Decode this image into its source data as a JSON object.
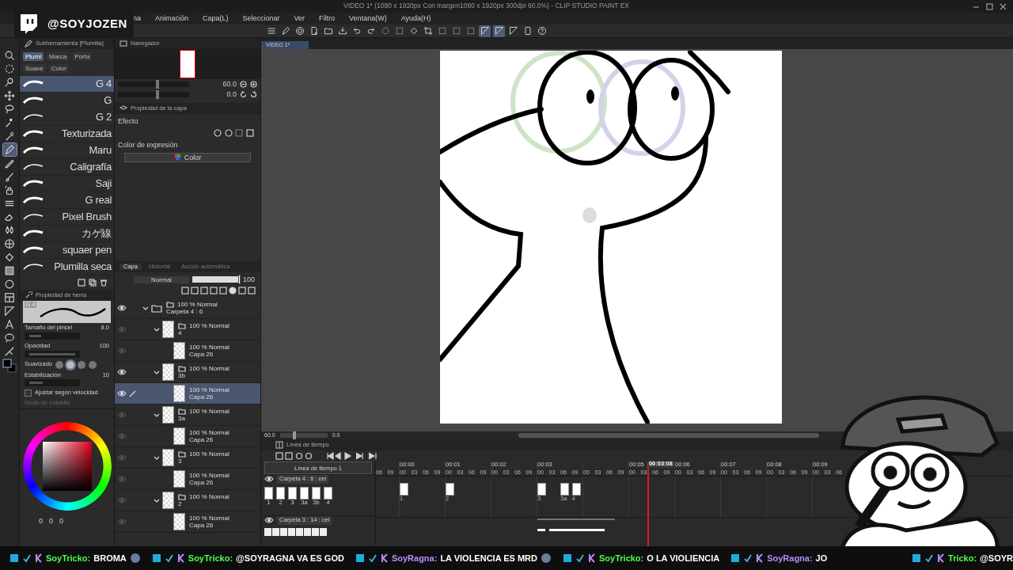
{
  "overlay": {
    "handle": "@SOYJOZEN"
  },
  "window": {
    "title": "VIDEO 1* (1080 x 1920px Con margen1080 x 1920px 300dpi 60.0%)  - CLIP STUDIO PAINT EX"
  },
  "menu": [
    "na",
    "Animación",
    "Capa(L)",
    "Seleccionar",
    "Ver",
    "Filtro",
    "Ventana(W)",
    "Ayuda(H)"
  ],
  "toolbar": [
    {
      "kind": "menu",
      "on": false
    },
    {
      "kind": "pen",
      "on": false
    },
    {
      "kind": "spiral",
      "on": false
    },
    {
      "kind": "new",
      "on": false
    },
    {
      "kind": "open",
      "on": false
    },
    {
      "kind": "save",
      "on": false
    },
    {
      "kind": "undo",
      "on": false
    },
    {
      "kind": "redo",
      "on": false
    },
    {
      "kind": "spinner",
      "on": false
    },
    {
      "kind": "blank",
      "on": false
    },
    {
      "kind": "fill",
      "on": false
    },
    {
      "kind": "crop",
      "on": false
    },
    {
      "kind": "blank",
      "on": false
    },
    {
      "kind": "blank",
      "on": false
    },
    {
      "kind": "blank",
      "on": false
    },
    {
      "kind": "ruler",
      "on": true
    },
    {
      "kind": "ruler",
      "on": true
    },
    {
      "kind": "ruler",
      "on": false
    },
    {
      "kind": "device",
      "on": false
    },
    {
      "kind": "help",
      "on": false
    }
  ],
  "tools": [
    {
      "kind": "zoom",
      "selected": false
    },
    {
      "kind": "select",
      "selected": false
    },
    {
      "kind": "eyedrop2",
      "selected": false
    },
    {
      "kind": "move",
      "selected": false
    },
    {
      "kind": "lasso",
      "selected": false
    },
    {
      "kind": "wand",
      "selected": false
    },
    {
      "kind": "eyedropper",
      "selected": false
    },
    {
      "kind": "pen",
      "selected": true
    },
    {
      "kind": "pencil",
      "selected": false
    },
    {
      "kind": "brush",
      "selected": false
    },
    {
      "kind": "airbrush",
      "selected": false
    },
    {
      "kind": "decoration",
      "selected": false
    },
    {
      "kind": "eraser",
      "selected": false
    },
    {
      "kind": "blend",
      "selected": false
    },
    {
      "kind": "frame",
      "selected": false
    },
    {
      "kind": "fill",
      "selected": false
    },
    {
      "kind": "gradient",
      "selected": false
    },
    {
      "kind": "figure",
      "selected": false
    },
    {
      "kind": "panel",
      "selected": false
    },
    {
      "kind": "ruler",
      "selected": false
    },
    {
      "kind": "text",
      "selected": false
    },
    {
      "kind": "balloon",
      "selected": false
    },
    {
      "kind": "correct",
      "selected": false
    }
  ],
  "subtool": {
    "title": "Subherramienta [Plumilla]",
    "groups": [
      {
        "label": "Plumi",
        "selected": true
      },
      {
        "label": "Marca",
        "selected": false
      },
      {
        "label": "Porta",
        "selected": false
      },
      {
        "label": "Suave",
        "selected": false
      },
      {
        "label": "Color",
        "selected": false
      }
    ],
    "brushes": [
      {
        "name": "G 4",
        "selected": true
      },
      {
        "name": "G",
        "selected": false
      },
      {
        "name": "G 2",
        "selected": false
      },
      {
        "name": "Texturizada",
        "selected": false
      },
      {
        "name": "Maru",
        "selected": false
      },
      {
        "name": "Caligrafía",
        "selected": false
      },
      {
        "name": "Saji",
        "selected": false
      },
      {
        "name": "G real",
        "selected": false
      },
      {
        "name": "Pixel Brush",
        "selected": false
      },
      {
        "name": "カゲ線",
        "selected": false
      },
      {
        "name": "squaer pen",
        "selected": false
      },
      {
        "name": "Plumilla seca",
        "selected": false
      }
    ]
  },
  "tool_property": {
    "title": "Propiedad de herra",
    "brush": "G 4",
    "rows": [
      {
        "kind": "slider",
        "label": "Tamaño del pincel",
        "value": "8.0",
        "level": 0.25
      },
      {
        "kind": "slider",
        "label": "Opacidad",
        "value": "100",
        "level": 1
      },
      {
        "kind": "smoothing",
        "label": "Suavizado",
        "options": [
          {
            "selected": false
          },
          {
            "selected": true
          },
          {
            "selected": false
          },
          {
            "selected": false
          }
        ]
      },
      {
        "kind": "slider",
        "label": "Estabilización",
        "value": "10",
        "level": 0.3
      }
    ],
    "speed": {
      "label": "Ajustar según velocidad",
      "checked": false
    },
    "mode_label": "Modo de estabiliz"
  },
  "color_values": [
    "0",
    "0",
    "0"
  ],
  "navigator": {
    "title": "Navegador",
    "sliders": [
      {
        "kind": "zoom",
        "value": "60.0",
        "level": 0.55
      },
      {
        "kind": "angle",
        "value": "0.0",
        "level": 0.55
      }
    ]
  },
  "layer_property": {
    "title": "Propiedad de la capa",
    "effect_label": "Efecto",
    "expression_label": "Color de expresión",
    "expression": "Color"
  },
  "layers": {
    "tabs": [
      {
        "label": "Capa",
        "selected": true
      },
      {
        "label": "Historial",
        "selected": false
      },
      {
        "label": "Acción automática",
        "selected": false
      }
    ],
    "blend_mode": "Normal",
    "opacity": {
      "value": "100",
      "level": 1
    },
    "tree": [
      {
        "kind": "folder",
        "mode": "100 % Normal",
        "name": "Carpeta 4 : 6",
        "visible": true,
        "selected": false,
        "expanded": true,
        "children": [
          {
            "kind": "folder",
            "mode": "100 % Normal",
            "name": "4",
            "visible": false,
            "selected": false,
            "expanded": true,
            "children": [
              {
                "kind": "layer",
                "mode": "100 % Normal",
                "name": "Capa 26",
                "visible": false,
                "selected": false
              }
            ]
          },
          {
            "kind": "folder",
            "mode": "100 % Normal",
            "name": "3b",
            "visible": true,
            "selected": false,
            "expanded": true,
            "children": [
              {
                "kind": "layer",
                "mode": "100 % Normal",
                "name": "Capa 26",
                "visible": true,
                "selected": true
              }
            ]
          },
          {
            "kind": "folder",
            "mode": "100 % Normal",
            "name": "3a",
            "visible": false,
            "selected": false,
            "expanded": true,
            "children": [
              {
                "kind": "layer",
                "mode": "100 % Normal",
                "name": "Capa 26",
                "visible": false,
                "selected": false
              }
            ]
          },
          {
            "kind": "folder",
            "mode": "100 % Normal",
            "name": "3",
            "visible": false,
            "selected": false,
            "expanded": true,
            "children": [
              {
                "kind": "layer",
                "mode": "100 % Normal",
                "name": "Capa 26",
                "visible": false,
                "selected": false
              }
            ]
          },
          {
            "kind": "folder",
            "mode": "100 % Normal",
            "name": "2",
            "visible": false,
            "selected": false,
            "expanded": true,
            "children": [
              {
                "kind": "layer",
                "mode": "100 % Normal",
                "name": "Capa 26",
                "visible": false,
                "selected": false
              }
            ]
          }
        ]
      }
    ]
  },
  "document_tab": "VIDEO 1*",
  "canvas_bar": {
    "zoom": "60.0",
    "level": 0.3,
    "angle": "0.0"
  },
  "timeline": {
    "title": "Línea de tiempo",
    "name": "Línea de tiempo 1",
    "current_time": "00:03:08",
    "level": 0.39,
    "preroll": [
      "06",
      "09"
    ],
    "seconds": [
      {
        "label": "00:00",
        "ticks": [
          {
            "label": "00",
            "cel": "1"
          },
          {
            "label": "03"
          },
          {
            "label": "06"
          },
          {
            "label": "09"
          }
        ]
      },
      {
        "label": "00:01",
        "ticks": [
          {
            "label": "00",
            "cel": "2"
          },
          {
            "label": "03"
          },
          {
            "label": "06"
          },
          {
            "label": "09"
          }
        ]
      },
      {
        "label": "00:02",
        "ticks": [
          {
            "label": "00"
          },
          {
            "label": "03"
          },
          {
            "label": "06"
          },
          {
            "label": "09"
          }
        ]
      },
      {
        "label": "00:03",
        "ticks": [
          {
            "label": "00",
            "cel": "3"
          },
          {
            "label": "03"
          },
          {
            "label": "06",
            "cel": "3a"
          },
          {
            "label": "09",
            "cel": "4"
          }
        ]
      },
      {
        "ticks": [
          {
            "label": "00"
          },
          {
            "label": "03"
          },
          {
            "label": "06"
          },
          {
            "label": "09"
          }
        ]
      },
      {
        "label": "00:05",
        "ticks": [
          {
            "label": "00"
          },
          {
            "label": "03"
          },
          {
            "label": "06"
          },
          {
            "label": "09"
          }
        ]
      },
      {
        "label": "00:06",
        "ticks": [
          {
            "label": "00"
          },
          {
            "label": "03"
          },
          {
            "label": "06"
          },
          {
            "label": "09"
          }
        ]
      },
      {
        "label": "00:07",
        "ticks": [
          {
            "label": "00"
          },
          {
            "label": "03"
          },
          {
            "label": "06"
          },
          {
            "label": "09"
          }
        ]
      },
      {
        "label": "00:08",
        "ticks": [
          {
            "label": "00"
          },
          {
            "label": "03"
          },
          {
            "label": "06"
          },
          {
            "label": "09"
          }
        ]
      },
      {
        "label": "00:09",
        "ticks": [
          {
            "label": "00"
          },
          {
            "label": "03"
          },
          {
            "label": "06"
          }
        ]
      }
    ],
    "tracks": [
      {
        "name": "Carpeta 4 : 6 : cel",
        "visible": true,
        "cels": [
          "1",
          "2",
          "3",
          "3a",
          "3b",
          "4"
        ]
      },
      {
        "name": "Carpeta 3 : 14 : cel",
        "visible": true
      }
    ]
  },
  "ticker": [
    {
      "kind": "message",
      "user": "SoyTricko:",
      "color": "#4dff4d",
      "text": "BROMA"
    },
    {
      "kind": "emote"
    },
    {
      "kind": "message",
      "user": "SoyTricko:",
      "color": "#4dff4d",
      "text": "@SOYRAGNA VA ES GOD"
    },
    {
      "kind": "message",
      "user": "SoyRagna:",
      "color": "#b58cff",
      "text": "LA VIOLENCIA ES MRD"
    },
    {
      "kind": "emote"
    },
    {
      "kind": "message",
      "user": "SoyTricko:",
      "color": "#4dff4d",
      "text": "O LA VIOLIENCIA"
    },
    {
      "kind": "message",
      "user": "SoyRagna:",
      "color": "#b58cff",
      "text": "JO"
    },
    {
      "kind": "message",
      "user": "Tricko:",
      "color": "#4dff4d",
      "text": "@SOYR"
    }
  ]
}
